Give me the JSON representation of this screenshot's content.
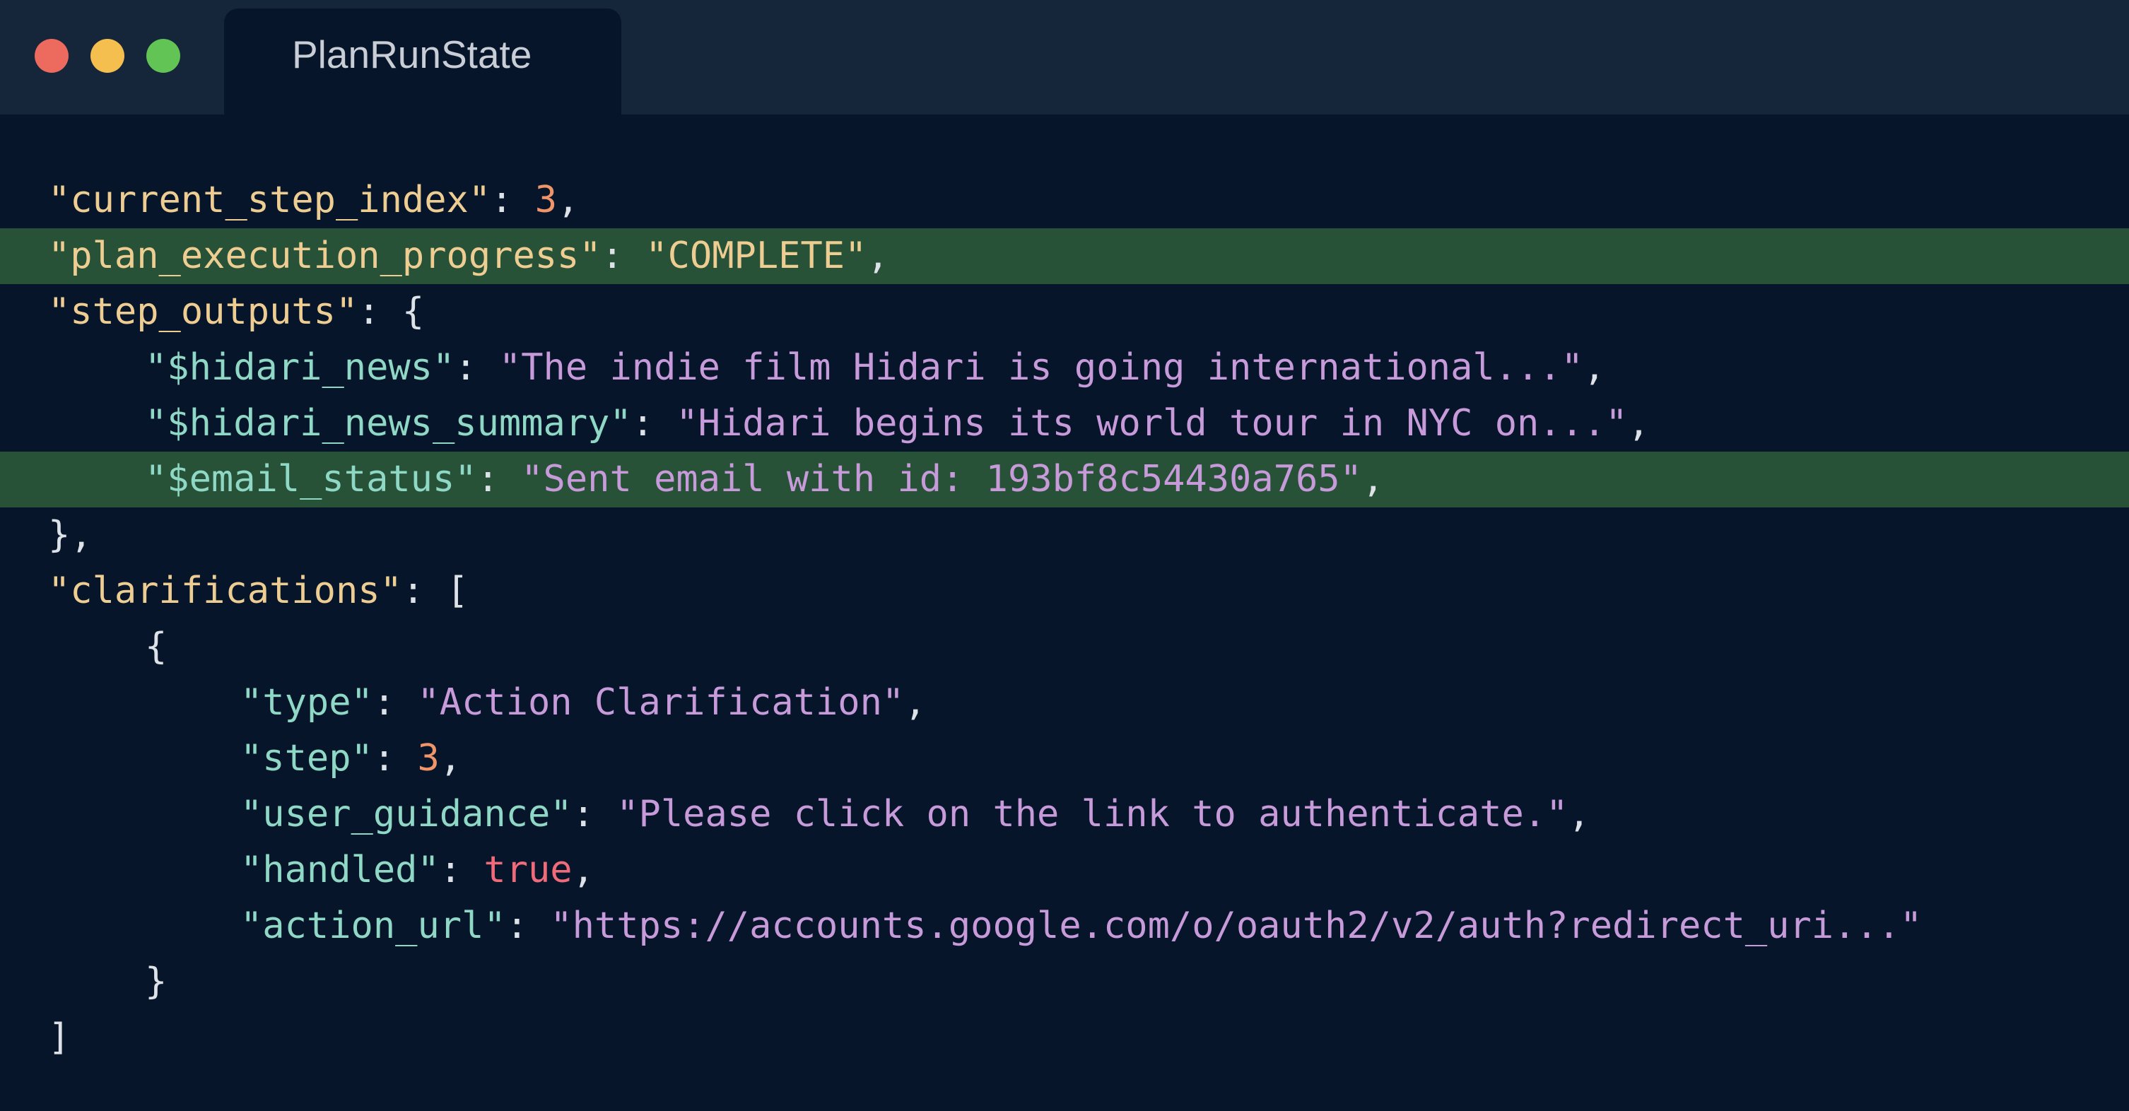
{
  "window": {
    "tab_title": "PlanRunState"
  },
  "code": {
    "current_step_index_key": "\"current_step_index\"",
    "current_step_index_value": "3",
    "plan_execution_progress_key": "\"plan_execution_progress\"",
    "plan_execution_progress_value": "\"COMPLETE\"",
    "step_outputs_key": "\"step_outputs\"",
    "hidari_news_key": "\"$hidari_news\"",
    "hidari_news_value": "\"The indie film Hidari is going international...\"",
    "hidari_news_summary_key": "\"$hidari_news_summary\"",
    "hidari_news_summary_value": "\"Hidari begins its world tour in NYC on...\"",
    "email_status_key": "\"$email_status\"",
    "email_status_value": "\"Sent email with id: 193bf8c54430a765\"",
    "clarifications_key": "\"clarifications\"",
    "type_key": "\"type\"",
    "type_value": "\"Action Clarification\"",
    "step_key": "\"step\"",
    "step_value": "3",
    "user_guidance_key": "\"user_guidance\"",
    "user_guidance_value": "\"Please click on the link to authenticate.\"",
    "handled_key": "\"handled\"",
    "handled_value": "true",
    "action_url_key": "\"action_url\"",
    "action_url_value": "\"https://accounts.google.com/o/oauth2/v2/auth?redirect_uri...\""
  },
  "colors": {
    "background": "#06152a",
    "titlebar": "#15253a",
    "highlight": "#275237",
    "top_level_key": "#eecd92",
    "nested_key": "#8fd8c6",
    "string": "#c79ad9",
    "number": "#f0946a",
    "boolean": "#f06b7a"
  }
}
